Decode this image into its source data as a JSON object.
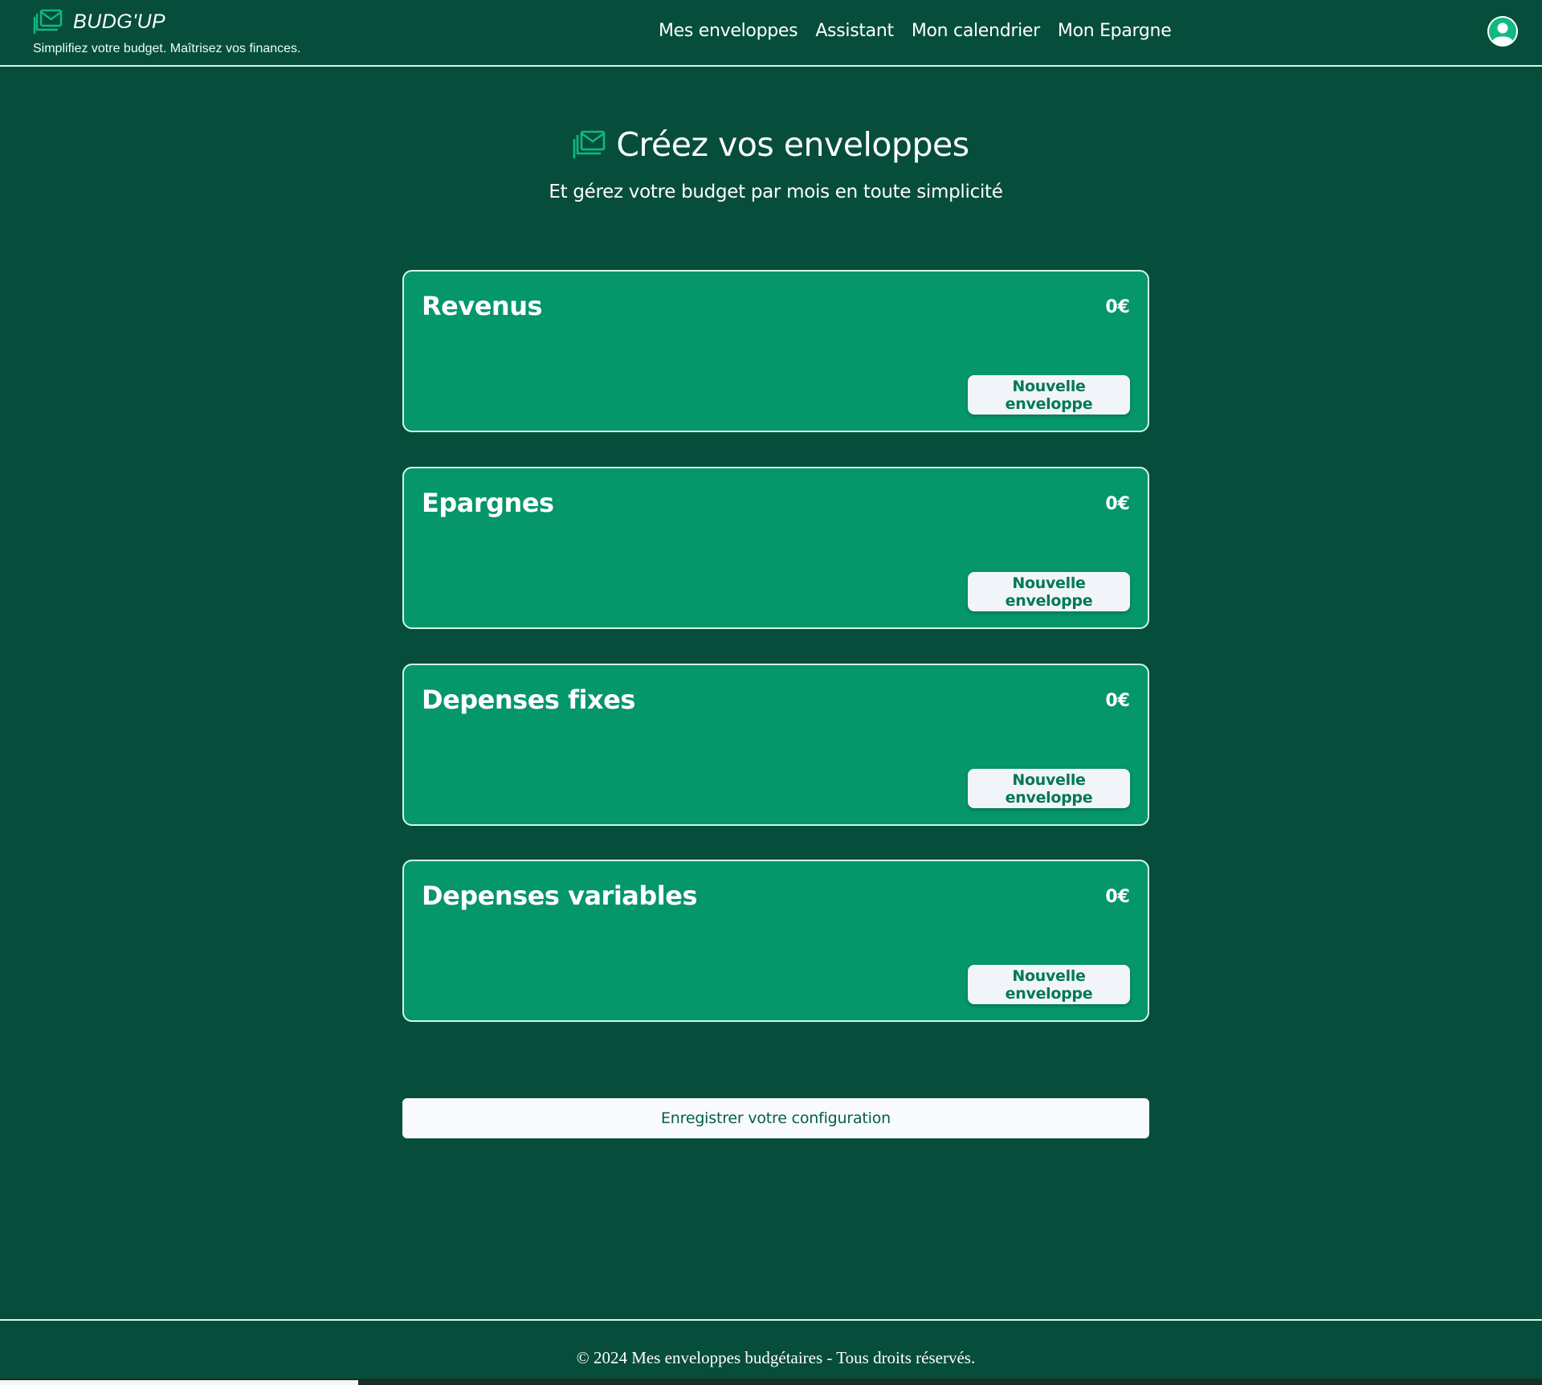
{
  "header": {
    "brand_name": "BUDG'UP",
    "tagline": "Simplifiez votre budget. Maîtrisez vos finances.",
    "nav": [
      {
        "label": "Mes enveloppes"
      },
      {
        "label": "Assistant"
      },
      {
        "label": "Mon calendrier"
      },
      {
        "label": "Mon Epargne"
      }
    ]
  },
  "hero": {
    "title": "Créez vos enveloppes",
    "subtitle": "Et gérez votre budget par mois en toute simplicité"
  },
  "categories": [
    {
      "title": "Revenus",
      "amount": "0€",
      "button": "Nouvelle enveloppe"
    },
    {
      "title": "Epargnes",
      "amount": "0€",
      "button": "Nouvelle enveloppe"
    },
    {
      "title": "Depenses fixes",
      "amount": "0€",
      "button": "Nouvelle enveloppe"
    },
    {
      "title": "Depenses variables",
      "amount": "0€",
      "button": "Nouvelle enveloppe"
    }
  ],
  "save_button": "Enregistrer votre configuration",
  "footer": {
    "text": "© 2024 Mes enveloppes budgétaires - Tous droits réservés."
  },
  "colors": {
    "background": "#064e3b",
    "card": "#059669",
    "accent_text": "#047857"
  }
}
